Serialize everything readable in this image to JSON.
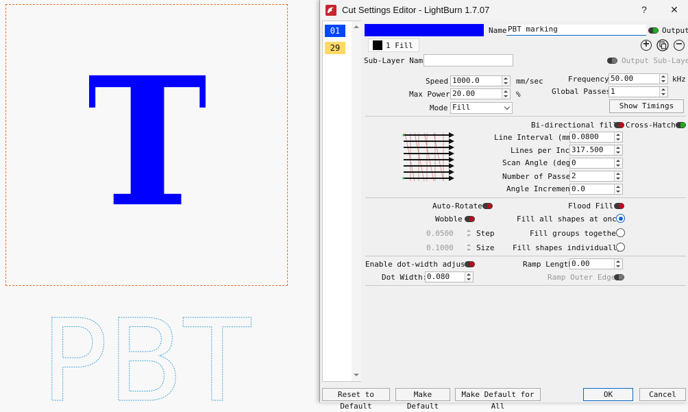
{
  "canvas": {
    "big_letter": "T",
    "outline_text": "PBT",
    "colors": {
      "frame": "#e07030",
      "big_letter": "#0000ff",
      "outline": "#3aa0d8"
    }
  },
  "window": {
    "title": "Cut Settings Editor - LightBurn 1.7.07",
    "help_label": "?",
    "close_label": "✕"
  },
  "layers": [
    {
      "label": "01",
      "color": "#0047ff"
    },
    {
      "label": "29",
      "color": "#ffd966"
    }
  ],
  "header": {
    "layer_color": "#0000ff",
    "name_label": "Name",
    "name_value": "PBT marking",
    "output_label": "Output",
    "sublayer_tab": "1 Fill",
    "sublayer_name_label": "Sub-Layer Name",
    "sublayer_name_value": "",
    "output_sublayer_label": "Output Sub-Layer",
    "add_icon": "plus-circle-icon",
    "dup_icon": "duplicate-icon",
    "remove_icon": "minus-circle-icon"
  },
  "params": {
    "speed_label": "Speed",
    "speed_value": "1000.0",
    "speed_unit": "mm/sec",
    "max_power_label": "Max Power",
    "max_power_value": "20.00",
    "max_power_unit": "%",
    "mode_label": "Mode",
    "mode_value": "Fill",
    "frequency_label": "Frequency",
    "frequency_value": "50.00",
    "frequency_unit": "kHz",
    "global_passes_label": "Global Passes",
    "global_passes_value": "1",
    "show_timings_label": "Show Timings"
  },
  "fill": {
    "bidir_label": "Bi-directional fill",
    "crosshatch_label": "Cross-Hatch",
    "line_interval_label": "Line Interval (mm)",
    "line_interval_value": "0.0800",
    "lines_per_inch_label": "Lines per Inch",
    "lines_per_inch_value": "317.500",
    "scan_angle_label": "Scan Angle (deg)",
    "scan_angle_value": "0",
    "num_passes_label": "Number of Passes",
    "num_passes_value": "2",
    "angle_inc_label": "Angle Increment",
    "angle_inc_value": "0.0"
  },
  "options": {
    "auto_rotate_label": "Auto-Rotate",
    "flood_fill_label": "Flood Fill",
    "wobble_label": "Wobble",
    "step_value": "0.0500",
    "step_label": "Step",
    "size_value": "0.1000",
    "size_label": "Size",
    "fill_all_label": "Fill all shapes at once",
    "fill_groups_label": "Fill groups together",
    "fill_individually_label": "Fill shapes individually"
  },
  "dot": {
    "enable_label": "Enable dot-width adjust",
    "dot_width_label": "Dot Width:",
    "dot_width_value": "0.080",
    "ramp_length_label": "Ramp Length",
    "ramp_length_value": "0.00",
    "ramp_outer_label": "Ramp Outer Edge"
  },
  "footer": {
    "reset_label": "Reset to Default",
    "make_default_label": "Make Default",
    "make_default_all_label": "Make Default for All",
    "ok_label": "OK",
    "cancel_label": "Cancel"
  }
}
